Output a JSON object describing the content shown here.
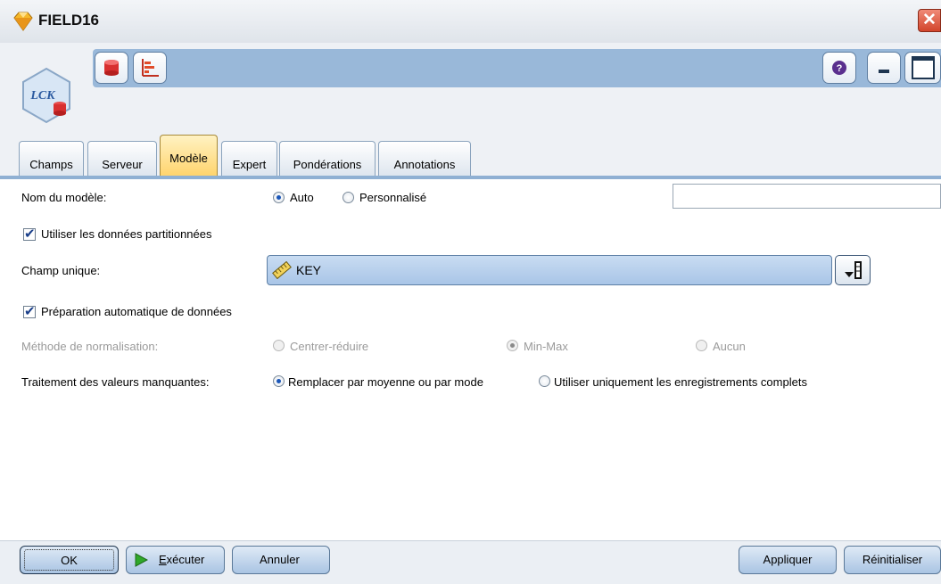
{
  "window": {
    "title": "FIELD16"
  },
  "toolbar": {
    "left_icons": [
      "database-icon",
      "bar-chart-icon"
    ],
    "right_icons": [
      "help-icon",
      "minimize-icon",
      "maximize-icon"
    ],
    "node_icon": "regression-node-icon"
  },
  "tabs": [
    {
      "label": "Champs",
      "active": false
    },
    {
      "label": "Serveur",
      "active": false
    },
    {
      "label": "Modèle",
      "active": true
    },
    {
      "label": "Expert",
      "active": false
    },
    {
      "label": "Pondérations",
      "active": false
    },
    {
      "label": "Annotations",
      "active": false
    }
  ],
  "form": {
    "model_name": {
      "label": "Nom du modèle:",
      "options": [
        "Auto",
        "Personnalisé"
      ],
      "selected": "Auto",
      "value": ""
    },
    "use_partitioned": {
      "label": "Utiliser les données partitionnées",
      "checked": true
    },
    "unique_field": {
      "label": "Champ unique:",
      "value": "KEY",
      "icon": "ruler-icon"
    },
    "auto_data_prep": {
      "label": "Préparation automatique de données",
      "checked": true
    },
    "normalization": {
      "label": "Méthode de normalisation:",
      "options": [
        "Centrer-réduire",
        "Min-Max",
        "Aucun"
      ],
      "selected": "Min-Max",
      "enabled": false
    },
    "missing_values": {
      "label": "Traitement des valeurs manquantes:",
      "options": [
        "Remplacer par moyenne ou par mode",
        "Utiliser uniquement les enregistrements complets"
      ],
      "selected": "Remplacer par moyenne ou par mode"
    }
  },
  "buttons": {
    "ok": "OK",
    "run": "Exécuter",
    "cancel": "Annuler",
    "apply": "Appliquer",
    "reset": "Réinitialiser"
  },
  "colors": {
    "accent": "#99b8d9",
    "active_tab": "#ffd36a",
    "run_green": "#2fa82a"
  }
}
